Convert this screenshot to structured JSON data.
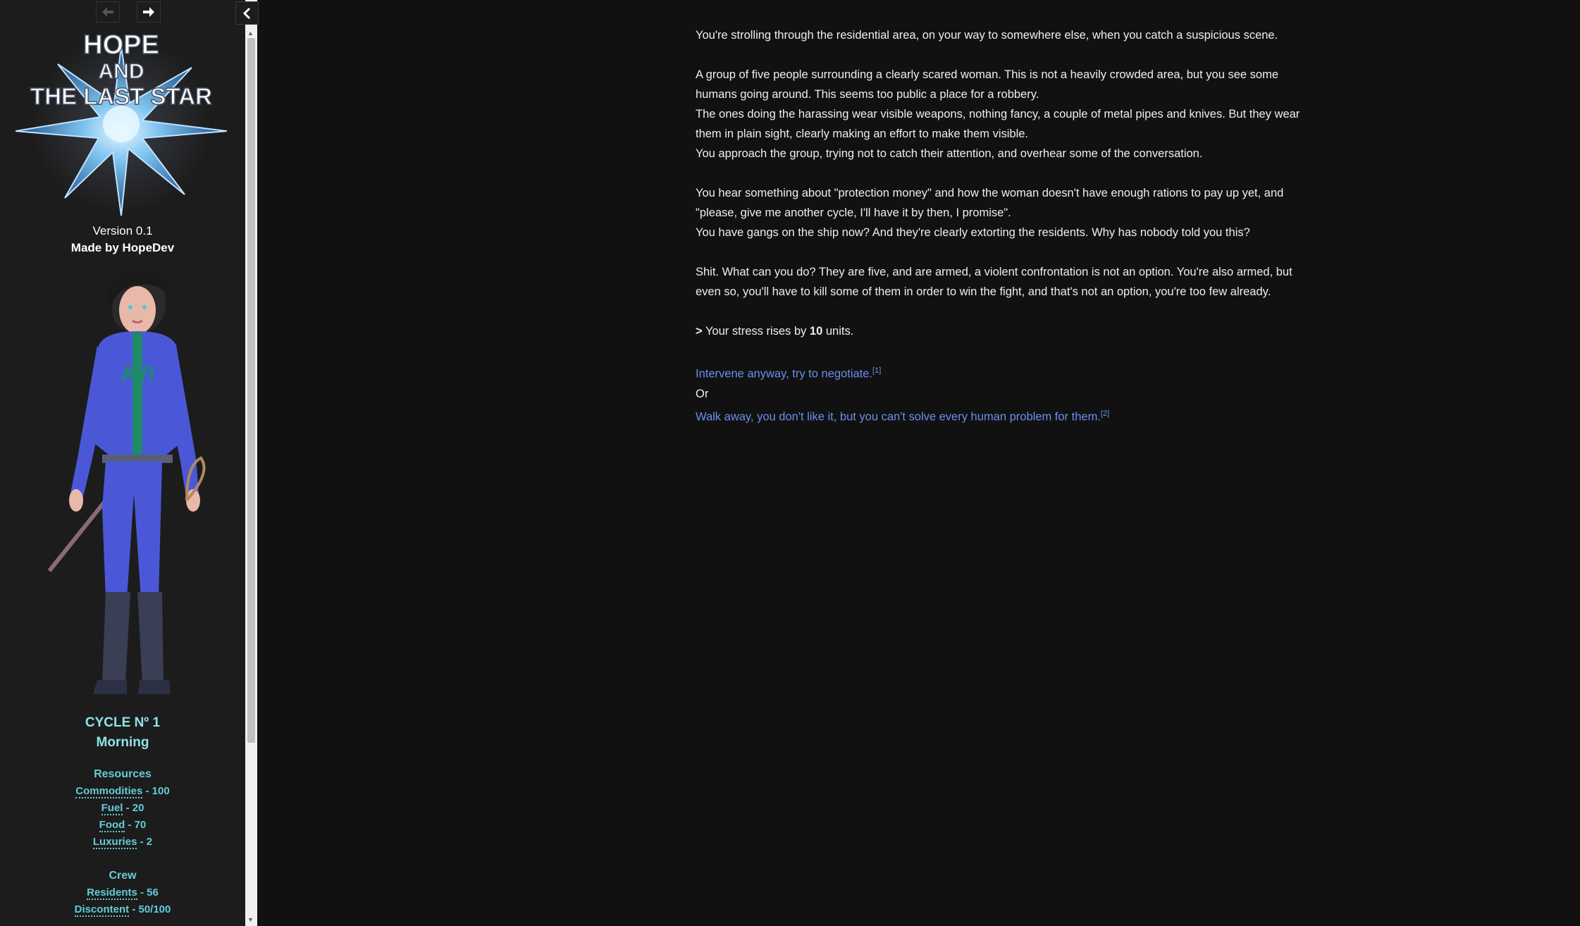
{
  "sidebar": {
    "logo": {
      "line1": "HOPE",
      "line2": "AND",
      "line3": "THE LAST STAR"
    },
    "version": "Version 0.1",
    "author": "Made by HopeDev",
    "portrait_chest_text": "AVI",
    "cycle": "CYCLE Nº 1",
    "time_of_day": "Morning",
    "resources": {
      "title": "Resources",
      "items": [
        {
          "name": "Commodities",
          "value": "- 100"
        },
        {
          "name": "Fuel",
          "value": "- 20"
        },
        {
          "name": "Food",
          "value": "- 70"
        },
        {
          "name": "Luxuries",
          "value": "- 2"
        }
      ]
    },
    "crew": {
      "title": "Crew",
      "items": [
        {
          "name": "Residents",
          "value": "- 56"
        },
        {
          "name": "Discontent",
          "value": "- 50/100"
        }
      ]
    }
  },
  "story": {
    "p1": "You're strolling through the residential area, on your way to somewhere else, when you catch a suspicious scene.",
    "p2": "A group of five people surrounding a clearly scared woman. This is not a heavily crowded area, but you see some humans going around. This seems too public a place for a robbery.",
    "p3": "The ones doing the harassing wear visible weapons, nothing fancy, a couple of metal pipes and knives. But they wear them in plain sight, clearly making an effort to make them visible.",
    "p4": "You approach the group, trying not to catch their attention, and overhear some of the conversation.",
    "p5": "You hear something about \"protection money\" and how the woman doesn't have enough rations to pay up yet, and \"please, give me another cycle, I'll have it by then, I promise\".",
    "p6": "You have gangs on the ship now? And they're clearly extorting the residents. Why has nobody told you this?",
    "p7": "Shit. What can you do? They are five, and are armed, a violent confrontation is not an option. You're also armed, but even so, you'll have to kill some of them in order to win the fight, and that's not an option, you're too few already.",
    "stress": {
      "marker": ">",
      "before": "Your stress rises by",
      "amount": "10",
      "after": "units."
    },
    "choice1": {
      "label": "Intervene anyway, try to negotiate.",
      "key": "[1]"
    },
    "or_text": "Or",
    "choice2": {
      "label": "Walk away, you don't like it, but you can't solve every human problem for them.",
      "key": "[2]"
    }
  }
}
